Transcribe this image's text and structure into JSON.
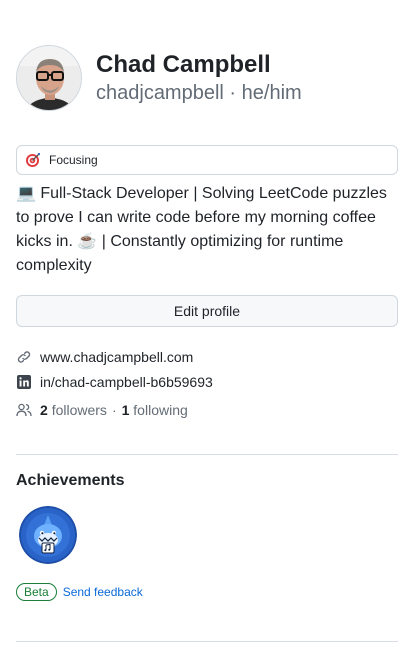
{
  "profile": {
    "name": "Chad Campbell",
    "login": "chadjcampbell",
    "separator": "·",
    "pronouns": "he/him"
  },
  "status": {
    "emoji": "dart-icon",
    "text": "Focusing"
  },
  "bio": "💻 Full-Stack Developer | Solving LeetCode puzzles to prove I can write code before my morning coffee kicks in. ☕ | Constantly optimizing for runtime complexity",
  "edit_button": "Edit profile",
  "links": {
    "website": "www.chadjcampbell.com",
    "linkedin": "in/chad-campbell-b6b59693"
  },
  "social": {
    "followers_count": "2",
    "followers_label": "followers",
    "dot": "·",
    "following_count": "1",
    "following_label": "following"
  },
  "achievements": {
    "title": "Achievements",
    "badge_icon": "shark-badge-icon"
  },
  "beta": {
    "label": "Beta",
    "feedback": "Send feedback"
  },
  "colors": {
    "text": "#1f2328",
    "muted": "#636c76",
    "border": "#d0d7de",
    "link": "#0969da",
    "beta": "#1a7f37"
  }
}
